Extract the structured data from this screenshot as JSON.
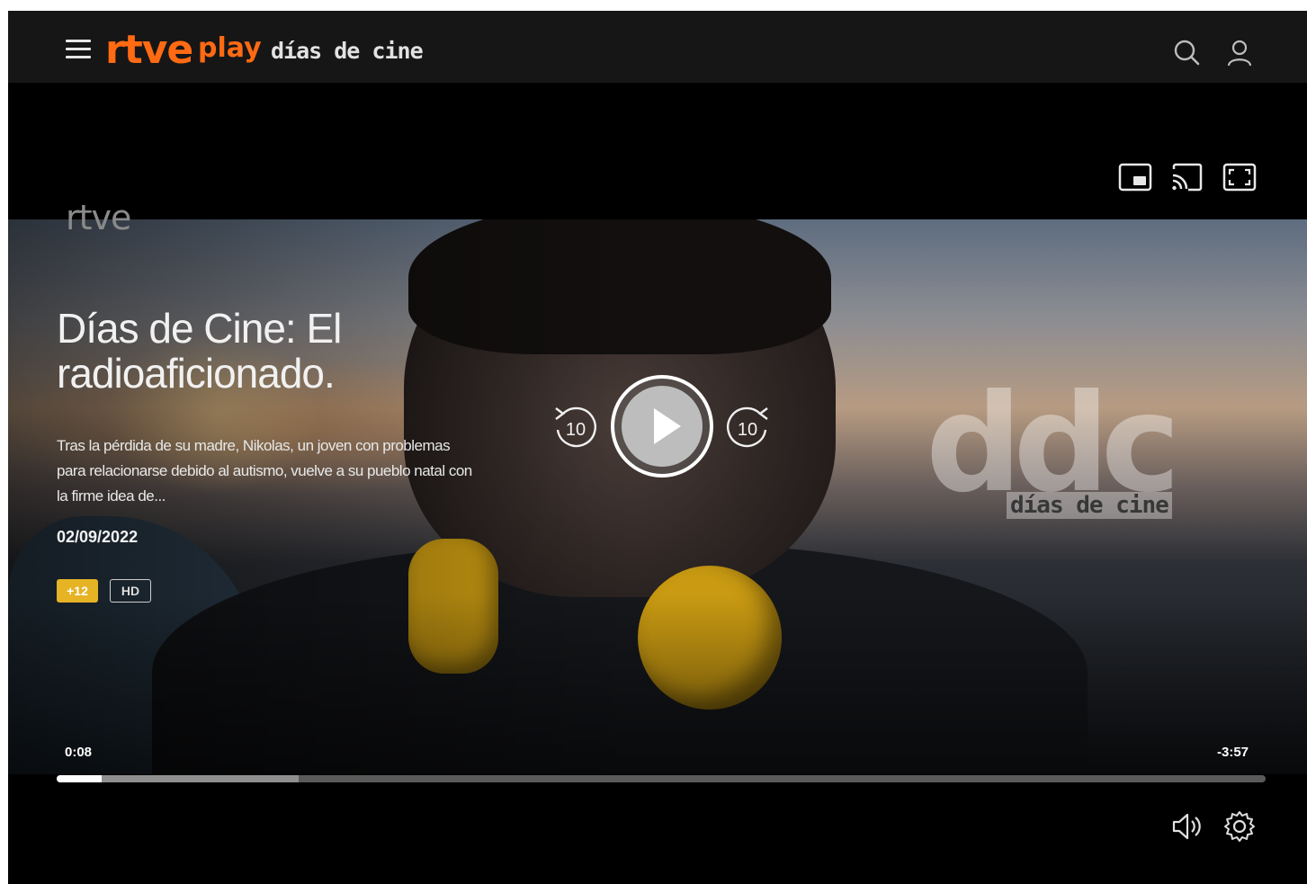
{
  "header": {
    "brand_rtve": "rtve",
    "brand_play": "play",
    "program_title": "días de cine"
  },
  "video": {
    "watermark": "rtve",
    "channel_logo_text": "días de cine",
    "channel_logo_letters": "ddc"
  },
  "episode": {
    "title": "Días de Cine: El radioaficionado.",
    "description": "Tras la pérdida de su madre, Nikolas, un joven con problemas para relacionarse debido al autismo, vuelve a su pueblo natal con la firme idea de...",
    "date": "02/09/2022",
    "age_rating": "+12",
    "quality": "HD"
  },
  "player": {
    "current_time": "0:08",
    "remaining_time": "-3:57",
    "skip_back_label": "10",
    "skip_forward_label": "10",
    "progress_played_fraction": 0.037,
    "progress_buffered_fraction": 0.2
  },
  "colors": {
    "brand_orange": "#ff6a13",
    "age_badge": "#e6b325",
    "player_background": "#000000"
  },
  "icons": {
    "menu": "hamburger-menu-icon",
    "search": "search-icon",
    "user": "user-icon",
    "pip": "picture-in-picture-icon",
    "cast": "cast-icon",
    "fullscreen": "fullscreen-icon",
    "play": "play-icon",
    "rewind": "rewind-10-icon",
    "forward": "forward-10-icon",
    "volume": "volume-icon",
    "settings": "gear-icon"
  }
}
